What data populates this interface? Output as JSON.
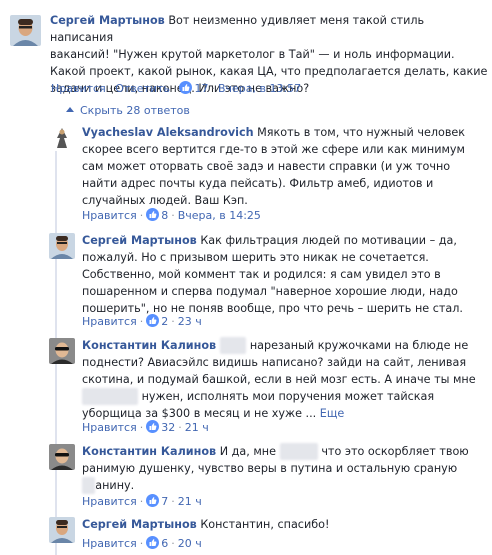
{
  "colors": {
    "link": "#365899",
    "action": "#4267b2",
    "meta": "#90949c",
    "text": "#1d2129",
    "thread_line": "#dfe3ee"
  },
  "top_comment": {
    "author": "Сергей Мартынов",
    "lines": [
      "Вот неизменно удивляет меня такой стиль написания",
      "вакансий! \"Нужен крутой маркетолог в Тай\" — и ноль информации.",
      "Какой проект, какой рынок, какая ЦА, что предполагается делать, какие",
      "задачи и цели, наконец. Или это не важно?"
    ],
    "like": "Нравится",
    "reply": "Ответить",
    "likes": "17",
    "time": "Вчера, в 13:57"
  },
  "replies_toggle": "Скрыть 28 ответов",
  "replies": [
    {
      "author": "Vyacheslav Aleksandrovich",
      "lines": [
        "Мякоть в том, что нужный человек",
        "скорее всего вертится где-то в этой же сфере или как минимум",
        "сам может оторвать своё задэ и навести справки (и уж точно",
        "найти адрес почты куда пейсать). Фильтр амеб, идиотов и",
        "случайных людей. Ваш Кэп."
      ],
      "like": "Нравится",
      "likes": "8",
      "time": "Вчера, в 14:25"
    },
    {
      "author": "Сергей Мартынов",
      "lines": [
        "Как фильтрация людей по мотивации – да,",
        "пожалуй. Но с призывом шерить это никак не сочетается.",
        "Собственно, мой коммент так и родился: я сам увидел это в",
        "пошаренном и сперва подумал \"наверное хорошие люди, надо",
        "пошерить\", но не поняв вообще, про что речь – шерить не стал."
      ],
      "like": "Нравится",
      "likes": "2",
      "time": "23 ч"
    },
    {
      "author": "Константин Калинов",
      "lines": [
        "нарезаный кружочками на блюде не",
        "поднести? Авиасэйлс видишь написано? зайди на сайт, ленивая",
        "скотина, и подумай башкой, если в ней мозг есть. А иначе ты мне",
        "нужен, исполнять мои поручения может тайская",
        "уборщица за $300 в месяц и не хуже ..."
      ],
      "more": "Еще",
      "like": "Нравится",
      "likes": "32",
      "time": "21 ч"
    },
    {
      "author": "Константин Калинов",
      "lines": [
        "И да, мне",
        "что это оскорбляет твою",
        "ранимую душенку, чувство веры в путина и остальную сраную",
        "анину."
      ],
      "like": "Нравится",
      "likes": "7",
      "time": "21 ч"
    },
    {
      "author": "Сергей Мартынов",
      "lines": [
        "Константин, спасибо!"
      ],
      "like": "Нравится",
      "likes": "6",
      "time": "20 ч"
    }
  ]
}
